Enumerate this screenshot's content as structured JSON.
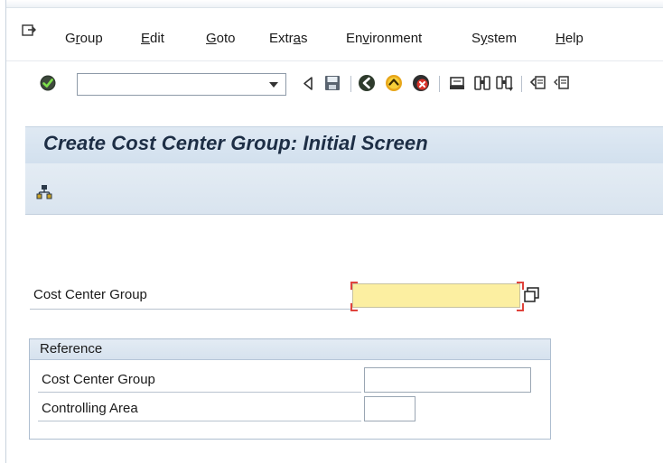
{
  "menu": {
    "icon": "menu-exit-icon",
    "items": [
      {
        "pre": "G",
        "u": "r",
        "post": "oup"
      },
      {
        "pre": "",
        "u": "E",
        "post": "dit"
      },
      {
        "pre": "",
        "u": "G",
        "post": "oto"
      },
      {
        "pre": "Extr",
        "u": "a",
        "post": "s"
      },
      {
        "pre": "En",
        "u": "v",
        "post": "ironment"
      },
      {
        "pre": "S",
        "u": "y",
        "post": "stem"
      },
      {
        "pre": "",
        "u": "H",
        "post": "elp"
      }
    ]
  },
  "toolbar": {
    "command_field_value": "",
    "icons": [
      "enter-checkmark-icon",
      "back-arrow-icon",
      "save-icon",
      "back-icon",
      "exit-icon",
      "cancel-icon",
      "print-icon",
      "find-icon",
      "find-next-icon",
      "first-page-icon",
      "previous-page-icon"
    ]
  },
  "title": "Create Cost Center Group: Initial Screen",
  "app_toolbar": {
    "icons": [
      "hierarchy-icon"
    ]
  },
  "form": {
    "cost_center_group_label": "Cost Center Group",
    "cost_center_group_value": "",
    "reference": {
      "title": "Reference",
      "cost_center_group_label": "Cost Center Group",
      "cost_center_group_value": "",
      "controlling_area_label": "Controlling Area",
      "controlling_area_value": ""
    }
  },
  "colors": {
    "title_text": "#1d2e45",
    "required_field": "#fcefa1",
    "required_marker": "#e0433c",
    "header_bg": "#d9e4ef"
  }
}
